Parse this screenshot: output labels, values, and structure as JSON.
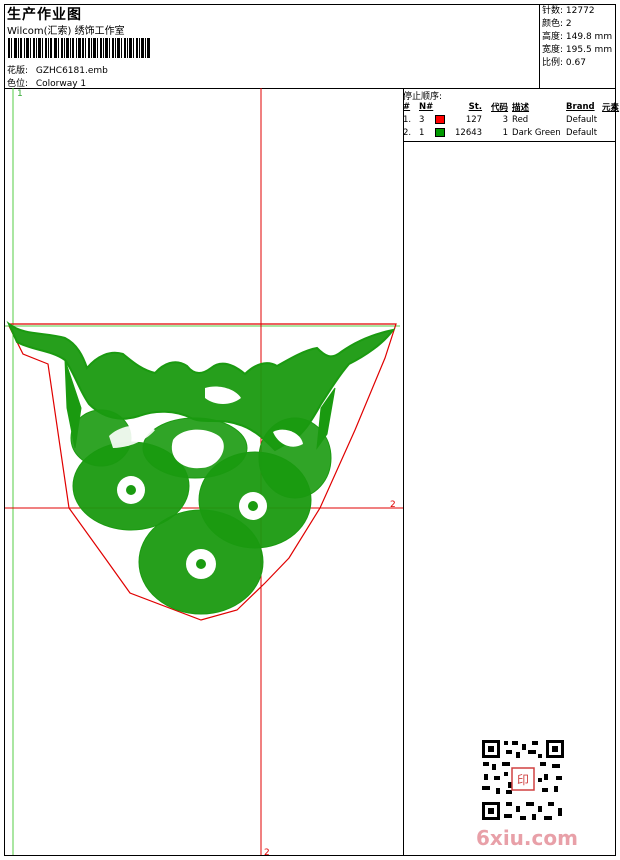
{
  "header": {
    "title": "生产作业图",
    "company": "Wilcom(汇索) 绣饰工作室",
    "design_label": "花版:",
    "design_value": "GZHC6181.emb",
    "colorway_label": "色位:",
    "colorway_value": "Colorway 1"
  },
  "stats": {
    "stitches_label": "针数:",
    "stitches_value": "12772",
    "colors_label": "颜色:",
    "colors_value": "2",
    "height_label": "高度:",
    "height_value": "149.8 mm",
    "width_label": "宽度:",
    "width_value": "195.5 mm",
    "scale_label": "比例:",
    "scale_value": "0.67"
  },
  "stop_sequence": {
    "title": "停止顺序:",
    "columns": [
      "#",
      "N#",
      "St.",
      "代码",
      "描述",
      "Brand",
      "元素"
    ],
    "rows": [
      {
        "index": "1.",
        "n": "3",
        "color": "#ff0000",
        "stitches": "127",
        "code": "3",
        "desc": "Red",
        "brand": "Default"
      },
      {
        "index": "2.",
        "n": "1",
        "color": "#009900",
        "stitches": "12643",
        "code": "1",
        "desc": "Dark Green",
        "brand": "Default"
      }
    ]
  },
  "canvas": {
    "marker_top": "1",
    "marker_right": "2",
    "marker_bottom": "2",
    "outline_color": "#e00000",
    "embroidery_color": "#1a9a10",
    "guide_color": "#55cc44"
  },
  "watermark": "6xiu.com",
  "qr_seal": "印"
}
